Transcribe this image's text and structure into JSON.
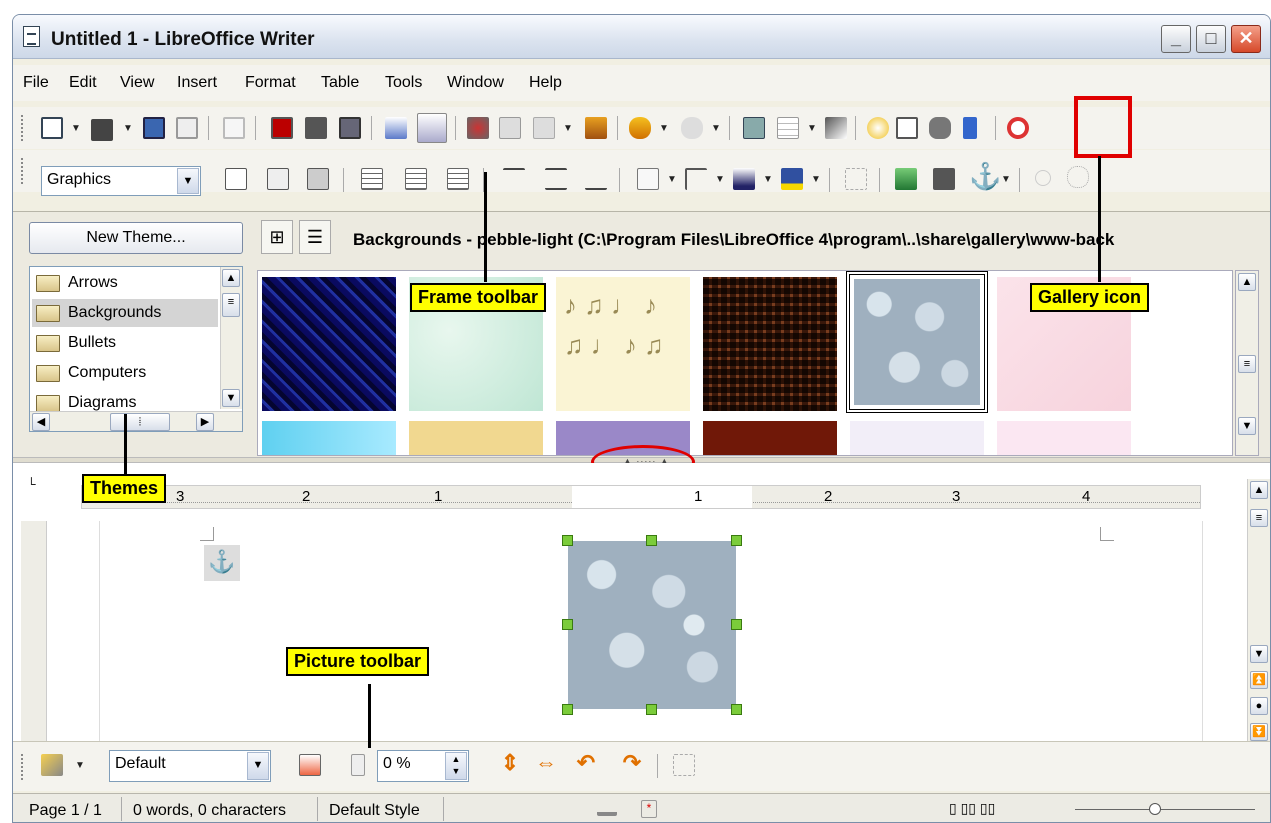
{
  "window": {
    "title": "Untitled 1 - LibreOffice Writer",
    "min": "_",
    "max": "□",
    "close": "✕"
  },
  "menu": [
    "File",
    "Edit",
    "View",
    "Insert",
    "Format",
    "Table",
    "Tools",
    "Window",
    "Help"
  ],
  "frame_toolbar": {
    "style_value": "Graphics"
  },
  "gallery": {
    "new_theme_label": "New Theme...",
    "path": "Backgrounds - pebble-light (C:\\Program Files\\LibreOffice 4\\program\\..\\share\\gallery\\www-back",
    "themes": [
      "Arrows",
      "Backgrounds",
      "Bullets",
      "Computers",
      "Diagrams"
    ],
    "selected_theme": "Backgrounds"
  },
  "ruler": {
    "labels": [
      "3",
      "2",
      "1",
      "1",
      "2",
      "3",
      "4"
    ]
  },
  "picture_toolbar": {
    "filter_value": "Default",
    "transparency_value": "0 %"
  },
  "callouts": {
    "frame_toolbar": "Frame toolbar",
    "gallery_icon": "Gallery icon",
    "themes": "Themes",
    "picture_toolbar": "Picture toolbar"
  },
  "status": {
    "page": "Page 1 / 1",
    "words": "0 words, 0 characters",
    "style": "Default Style"
  },
  "colors": {
    "callout": "#ffff00",
    "highlight": "#e00000",
    "selection_handle": "#7bcc3a"
  }
}
